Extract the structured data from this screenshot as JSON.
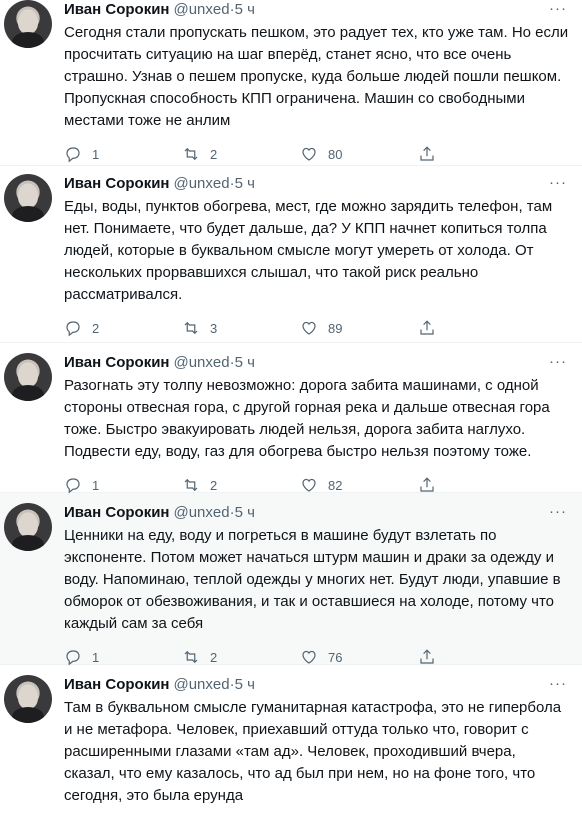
{
  "tweets": [
    {
      "name": "Иван Сорокин",
      "handle": "@unxed",
      "time": "5 ч",
      "text": "Сегодня стали пропускать пешком, это радует тех, кто уже там. Но если просчитать ситуацию на шаг вперёд, станет ясно, что все очень страшно. Узнав о пешем пропуске, куда больше людей пошли пешком. Пропускная способность КПП ограничена. Машин со свободными местами тоже не анлим",
      "replies": "1",
      "retweets": "2",
      "likes": "80"
    },
    {
      "name": "Иван Сорокин",
      "handle": "@unxed",
      "time": "5 ч",
      "text": "Еды, воды, пунктов обогрева, мест, где можно зарядить телефон, там нет. Понимаете, что будет дальше, да? У КПП начнет копиться толпа людей, которые в буквальном смысле могут умереть от холода. От нескольких прорвавшихся слышал, что такой риск реально рассматривался.",
      "replies": "2",
      "retweets": "3",
      "likes": "89"
    },
    {
      "name": "Иван Сорокин",
      "handle": "@unxed",
      "time": "5 ч",
      "text": "Разогнать эту толпу невозможно: дорога забита машинами, с одной стороны отвесная гора, с другой горная река и дальше отвесная гора тоже. Быстро эвакуировать людей нельзя, дорога забита наглухо. Подвести еду, воду, газ для обогрева быстро нельзя поэтому тоже.",
      "replies": "1",
      "retweets": "2",
      "likes": "82"
    },
    {
      "name": "Иван Сорокин",
      "handle": "@unxed",
      "time": "5 ч",
      "text": "Ценники на еду, воду и погреться в машине будут взлетать по экспоненте. Потом может начаться штурм машин и драки за одежду и воду. Напоминаю, теплой одежды у многих нет. Будут люди, упавшие в обморок от обезвоживания, и так и оставшиеся на холоде, потому что каждый сам за себя",
      "replies": "1",
      "retweets": "2",
      "likes": "76"
    },
    {
      "name": "Иван Сорокин",
      "handle": "@unxed",
      "time": "5 ч",
      "text": "Там в буквальном смысле гуманитарная катастрофа, это не гипербола и не метафора. Человек, приехавший оттуда только что, говорит с расширенными глазами «там ад». Человек, проходивший вчера, сказал, что ему казалось, что ад был при нем, но на фоне того, что сегодня, это была ерунда"
    }
  ],
  "more_label": "···",
  "separator": " · "
}
